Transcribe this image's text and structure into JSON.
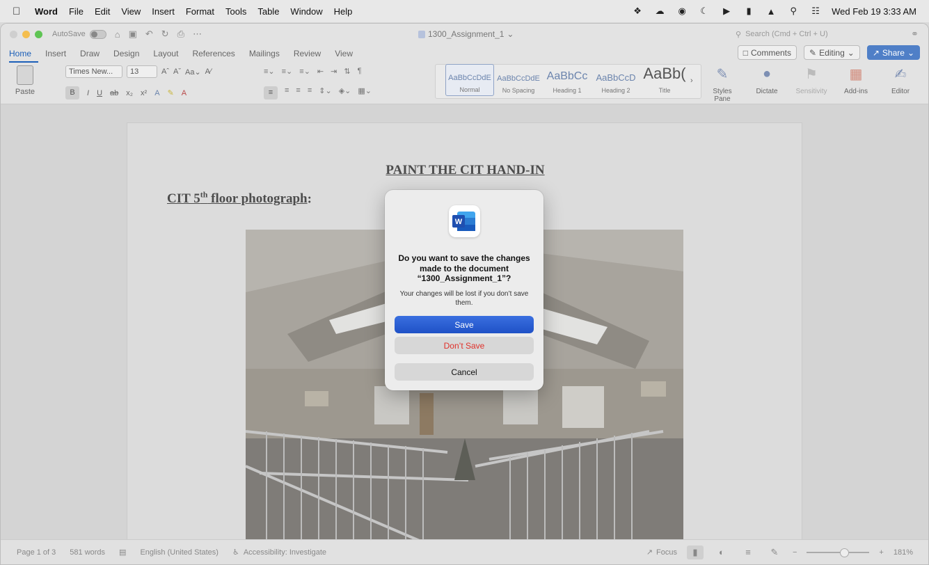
{
  "menubar": {
    "app_name": "Word",
    "items": [
      "File",
      "Edit",
      "View",
      "Insert",
      "Format",
      "Tools",
      "Table",
      "Window",
      "Help"
    ],
    "clock": "Wed Feb 19  3:33 AM"
  },
  "window": {
    "autosave_label": "AutoSave",
    "doc_title": "1300_Assignment_1",
    "search_placeholder": "Search (Cmd + Ctrl + U)"
  },
  "ribbon": {
    "tabs": [
      "Home",
      "Insert",
      "Draw",
      "Design",
      "Layout",
      "References",
      "Mailings",
      "Review",
      "View"
    ],
    "active_tab": "Home",
    "comments_label": "Comments",
    "editing_label": "Editing",
    "share_label": "Share",
    "paste_label": "Paste",
    "font_name": "Times New...",
    "font_size": "13",
    "styles": [
      {
        "sample": "AaBbCcDdE",
        "name": "Normal"
      },
      {
        "sample": "AaBbCcDdE",
        "name": "No Spacing"
      },
      {
        "sample": "AaBbCc",
        "name": "Heading 1"
      },
      {
        "sample": "AaBbCcD",
        "name": "Heading 2"
      },
      {
        "sample": "AaBb(",
        "name": "Title"
      }
    ],
    "styles_pane_label": "Styles Pane",
    "dictate_label": "Dictate",
    "sensitivity_label": "Sensitivity",
    "addins_label": "Add-ins",
    "editor_label": "Editor"
  },
  "document": {
    "heading": "PAINT THE CIT HAND-IN",
    "subheading_pre": "CIT 5",
    "subheading_sup": "th",
    "subheading_post": " floor photograph",
    "subheading_colon": ":"
  },
  "statusbar": {
    "page": "Page 1 of 3",
    "words": "581 words",
    "language": "English (United States)",
    "accessibility": "Accessibility: Investigate",
    "focus": "Focus",
    "zoom": "181%"
  },
  "dialog": {
    "title": "Do you want to save the changes made to the document “1300_Assignment_1”?",
    "message": "Your changes will be lost if you don’t save them.",
    "save": "Save",
    "dont_save": "Don’t Save",
    "cancel": "Cancel"
  },
  "colors": {
    "accent": "#2b60d6",
    "destructive": "#e0302a",
    "word_blue": "#2a5fc6"
  }
}
